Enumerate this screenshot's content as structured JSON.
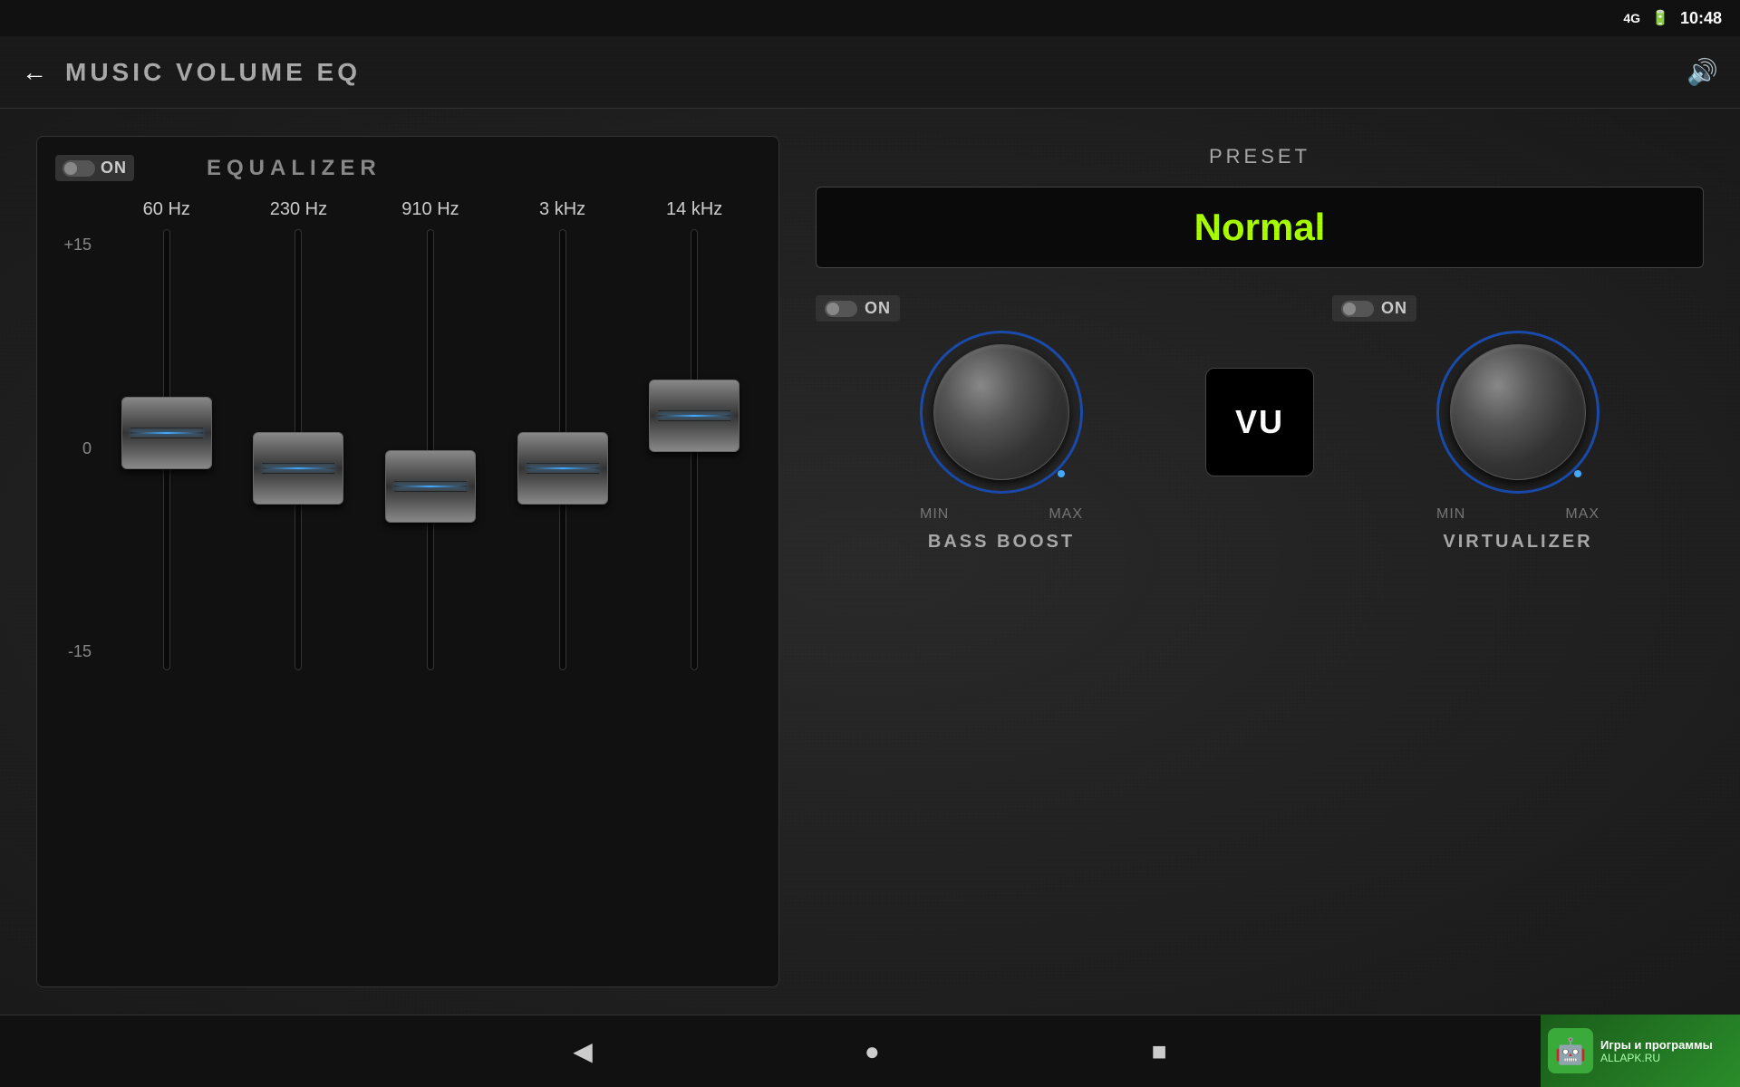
{
  "status_bar": {
    "signal": "4G",
    "battery_icon": "🔋",
    "time": "10:48"
  },
  "top_bar": {
    "back_icon": "←",
    "title": "MUSIC VOLUME EQ",
    "volume_icon": "🔊"
  },
  "equalizer": {
    "section_title": "EQUALIZER",
    "toggle_label": "ON",
    "bands": [
      {
        "freq": "60 Hz",
        "position": 45
      },
      {
        "freq": "230 Hz",
        "position": 55
      },
      {
        "freq": "910 Hz",
        "position": 58
      },
      {
        "freq": "3 kHz",
        "position": 55
      },
      {
        "freq": "14 kHz",
        "position": 42
      }
    ],
    "db_labels": [
      "+15",
      "0",
      "-15"
    ]
  },
  "preset": {
    "label": "PRESET",
    "value": "Normal"
  },
  "bass_boost": {
    "label": "BASS BOOST",
    "toggle_label": "ON",
    "min_label": "MIN",
    "max_label": "MAX"
  },
  "virtualizer": {
    "label": "VIRTUALIZER",
    "toggle_label": "ON",
    "min_label": "MIN",
    "max_label": "MAX"
  },
  "vu_meter": {
    "label": "VU"
  },
  "nav_bar": {
    "back_icon": "◀",
    "home_icon": "●",
    "recent_icon": "■"
  },
  "ad_banner": {
    "icon": "🤖",
    "line1": "Игры и программы",
    "line2": "ALLAPK.RU"
  }
}
